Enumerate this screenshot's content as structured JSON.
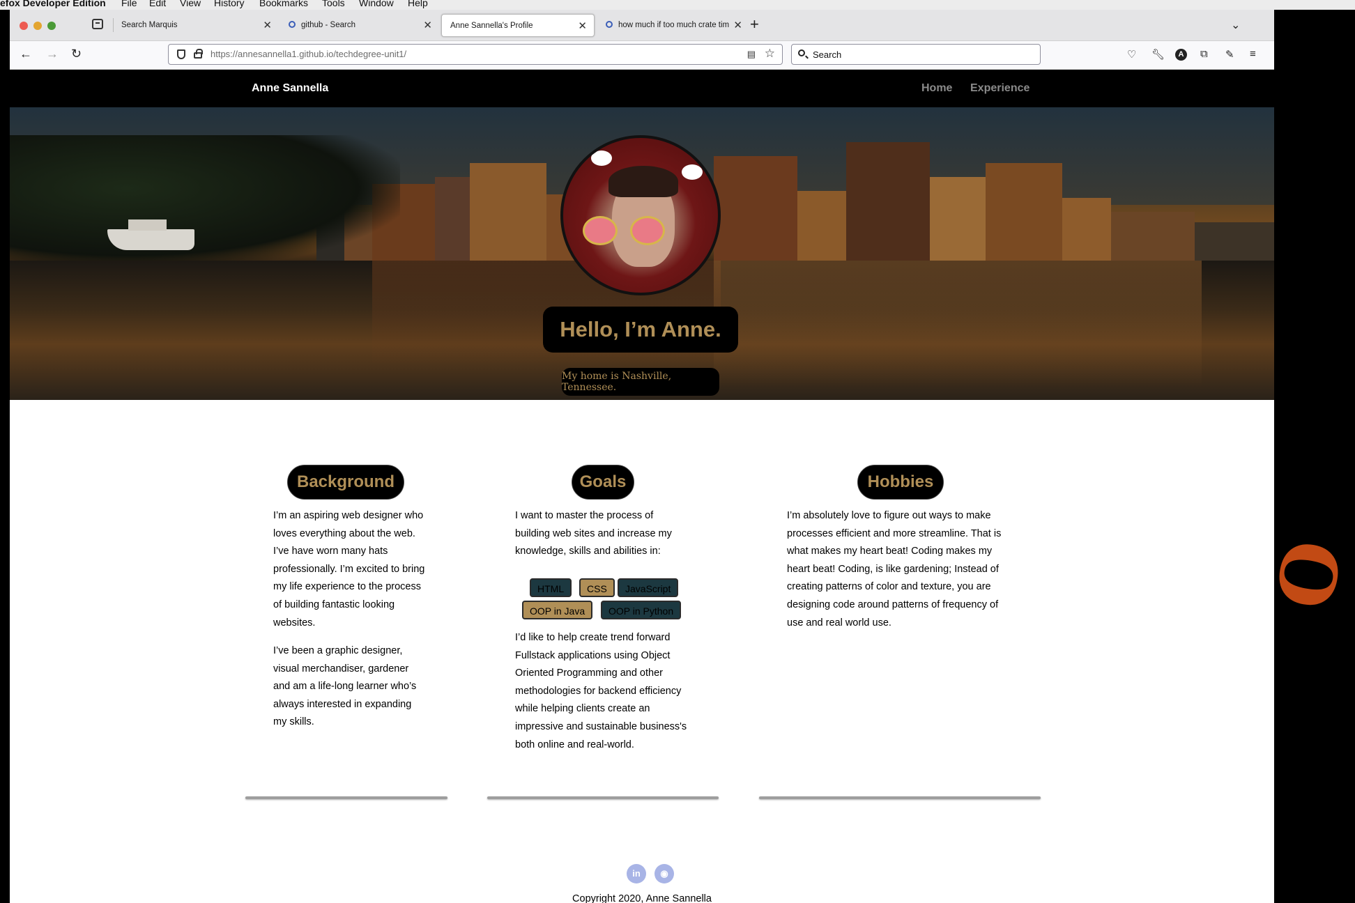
{
  "menubar": {
    "app_name": "efox Developer Edition",
    "items": [
      "File",
      "Edit",
      "View",
      "History",
      "Bookmarks",
      "Tools",
      "Window",
      "Help"
    ]
  },
  "tabs": [
    {
      "title": "Search Marquis",
      "active": false
    },
    {
      "title": "github - Search",
      "active": false
    },
    {
      "title": "Anne Sannella's Profile",
      "active": true
    },
    {
      "title": "how much if too much crate tim",
      "active": false
    }
  ],
  "urlbar": {
    "host": "https://annesannella1.github.io",
    "path": "/techdegree-unit1/"
  },
  "searchbar": {
    "placeholder": "Search"
  },
  "site": {
    "brand": "Anne Sannella",
    "nav": [
      "Home",
      "Experience"
    ],
    "hero_title": "Hello, I’m Anne.",
    "hero_subtitle": "My home is Nashville, Tennessee."
  },
  "background": {
    "heading": "Background",
    "paragraphs": [
      "I’m an aspiring web designer who loves everything about the web. I’ve have worn many hats professionally. I’m excited to bring my life experience to the process of building fantastic looking websites.",
      "I’ve been a graphic designer, visual merchandiser, gardener and am a life-long learner who’s always interested in expanding my skills."
    ]
  },
  "goals": {
    "heading": "Goals",
    "intro": "I want to master the process of building web sites and increase my knowledge, skills and abilities in:",
    "skills": [
      "HTML",
      "CSS",
      "JavaScript",
      "OOP in Java",
      "OOP in Python"
    ],
    "outro": "I’d like to help create trend forward Fullstack applications using Object Oriented Programming and other methodologies for backend efficiency while helping clients create an impressive and sustainable business's both online and real-world."
  },
  "hobbies": {
    "heading": "Hobbies",
    "text": "I’m absolutely love to figure out ways to make processes efficient and more streamline. That is what makes my heart beat! Coding makes my heart beat! Coding, is like gardening; Instead of creating patterns of color and texture, you are designing code around patterns of frequency of use and real world use."
  },
  "footer": {
    "social": [
      {
        "icon": "linkedin-icon",
        "glyph": "in"
      },
      {
        "icon": "github-icon",
        "glyph": "◉"
      }
    ],
    "copyright": "Copyright 2020, Anne Sannella"
  },
  "colors": {
    "accent_gold": "#b08f57",
    "skill_dark": "#1c3840",
    "header_bg": "#000000"
  }
}
